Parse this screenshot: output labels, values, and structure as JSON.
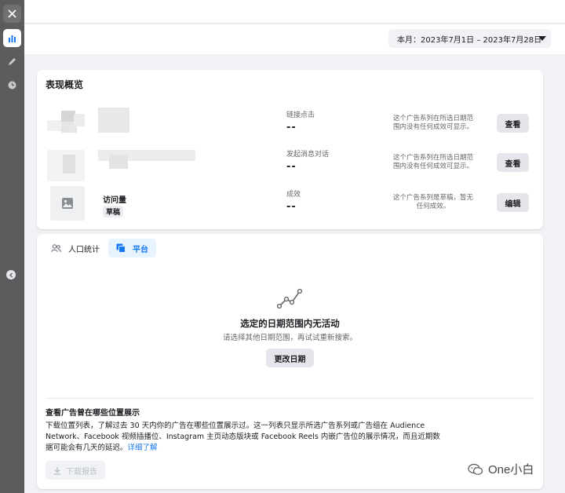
{
  "toolbar": {
    "date_range": "本月：2023年7月1日 – 2023年7月28日"
  },
  "overview": {
    "title": "表现概览",
    "rows": [
      {
        "name": "",
        "badge": "",
        "metric_label": "链接点击",
        "metric_value": "--",
        "note": "这个广告系列在所选日期范围内没有任何成效可显示。",
        "action": "查看"
      },
      {
        "name": "",
        "badge": "",
        "metric_label": "发起消息对话",
        "metric_value": "--",
        "note": "这个广告系列在所选日期范围内没有任何成效可显示。",
        "action": "查看"
      },
      {
        "name": "访问量",
        "badge": "草稿",
        "metric_label": "成效",
        "metric_value": "--",
        "note": "这个广告系列是草稿，暂无任何成效。",
        "action": "编辑"
      }
    ]
  },
  "platform": {
    "tabs": [
      {
        "label": "人口统计",
        "active": false
      },
      {
        "label": "平台",
        "active": true
      }
    ],
    "empty_title": "选定的日期范围内无活动",
    "empty_sub": "请选择其他日期范围，再试试重新搜索。",
    "change_date": "更改日期",
    "section_title": "查看广告曾在哪些位置展示",
    "section_body": "下载位置列表，了解过去 30 天内你的广告在哪些位置展示过。这一列表只显示所选广告系列或广告组在 Audience Network、Facebook 视频插播位、Instagram 主页动态版块或 Facebook Reels 内嵌广告位的展示情况，而且近期数据可能会有几天的延迟。",
    "learn_more": "详细了解",
    "download": "下载报告"
  },
  "watermark": "One小白",
  "icons": {
    "close": "close-icon",
    "stats": "bar-chart-icon",
    "edit": "pencil-icon",
    "history": "clock-icon",
    "collapse": "chevron-left-icon",
    "people": "people-icon",
    "platform": "stacked-squares-icon",
    "trend": "line-chart-icon",
    "image": "image-icon",
    "download": "download-icon"
  },
  "colors": {
    "accent": "#1877f2",
    "rail": "#5a5c5e",
    "tab_active_bg": "#e7f3ff"
  }
}
